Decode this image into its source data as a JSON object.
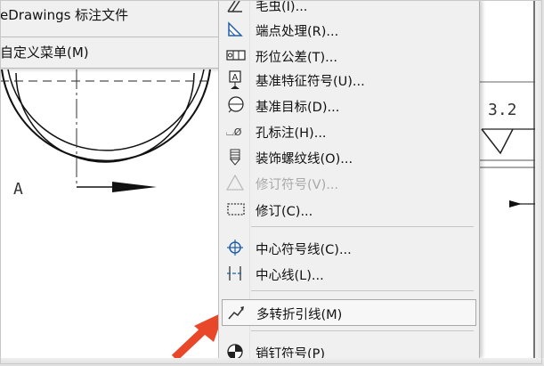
{
  "left_menu": {
    "items": [
      {
        "label": "eDrawings 标注文件"
      },
      {
        "label": "自定义菜单(M)"
      }
    ]
  },
  "context_menu": {
    "items": [
      {
        "label": "毛虫(I)...",
        "icon": "hatch-icon",
        "enabled": true
      },
      {
        "label": "端点处理(R)...",
        "icon": "endpoint-treatment-icon",
        "enabled": true
      },
      {
        "label": "形位公差(T)...",
        "icon": "geometric-tolerance-icon",
        "enabled": true
      },
      {
        "label": "基准特征符号(U)...",
        "icon": "datum-feature-icon",
        "enabled": true
      },
      {
        "label": "基准目标(D)...",
        "icon": "datum-target-icon",
        "enabled": true
      },
      {
        "label": "孔标注(H)...",
        "icon": "hole-callout-icon",
        "enabled": true
      },
      {
        "label": "装饰螺纹线(O)...",
        "icon": "cosmetic-thread-icon",
        "enabled": true
      },
      {
        "label": "修订符号(V)...",
        "icon": "revision-symbol-icon",
        "enabled": false
      },
      {
        "label": "修订(C)...",
        "icon": "revision-cloud-icon",
        "enabled": true
      },
      {
        "label": "中心符号线(C)...",
        "icon": "center-mark-icon",
        "enabled": true
      },
      {
        "label": "中心线(L)...",
        "icon": "centerline-icon",
        "enabled": true
      },
      {
        "label": "多转折引线(M)",
        "icon": "multi-jog-leader-icon",
        "enabled": true,
        "highlighted": true
      },
      {
        "label": "销钉符号(P)",
        "icon": "dowel-pin-icon",
        "enabled": true
      }
    ]
  },
  "drawing": {
    "section_label": "A",
    "roughness_value": "3.2"
  },
  "colors": {
    "pointer_arrow": "#e8472a",
    "menu_bg": "#f0f0f0"
  }
}
